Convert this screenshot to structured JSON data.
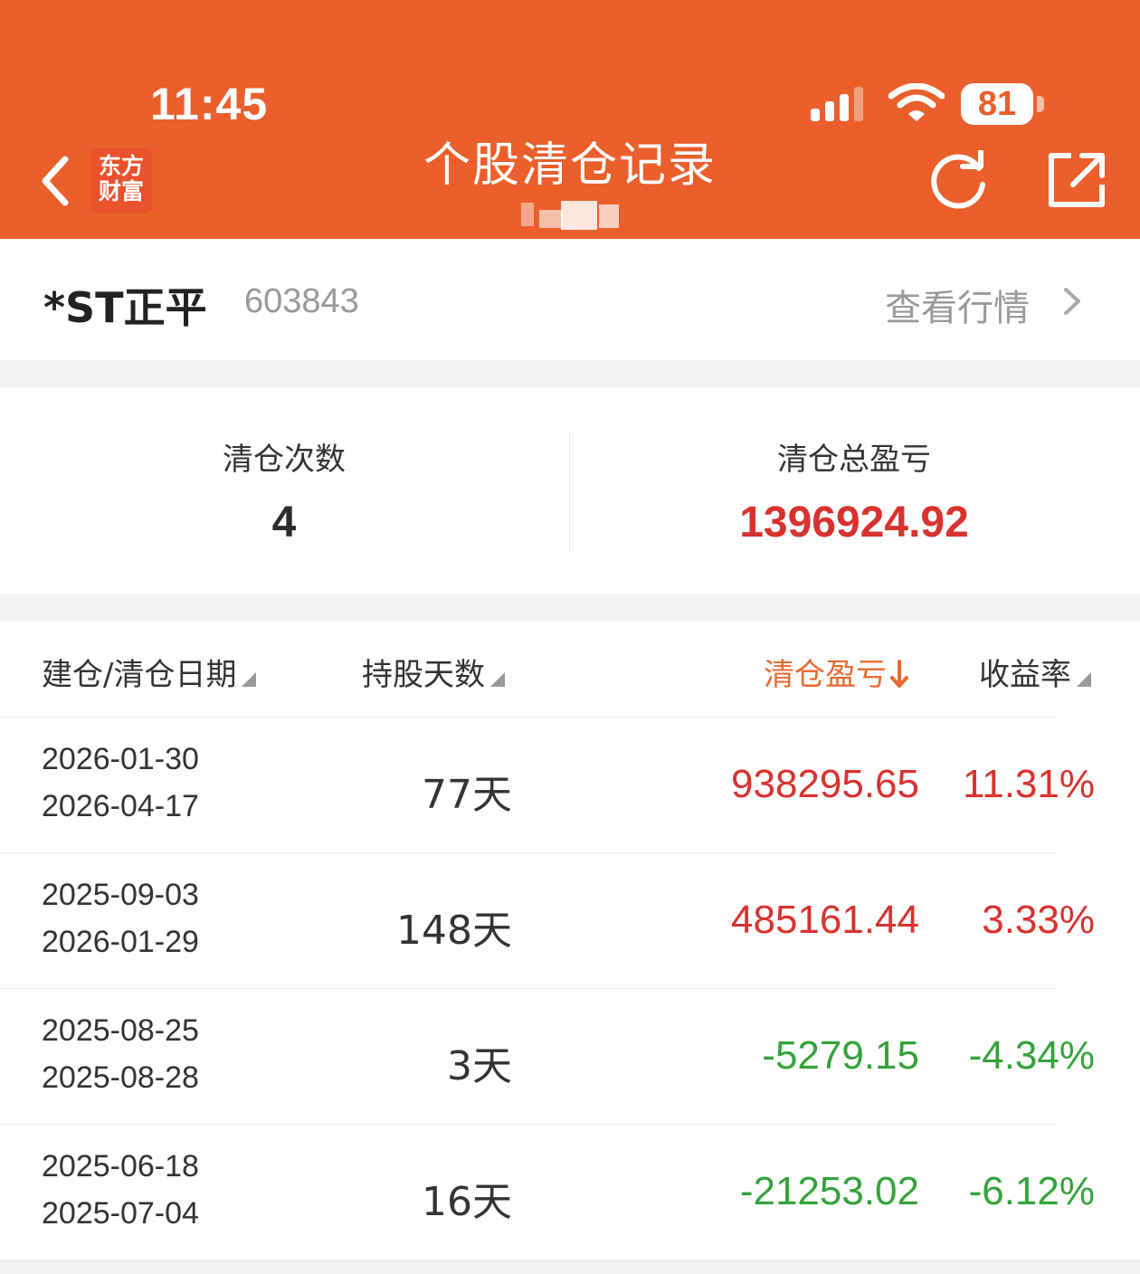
{
  "status_bar": {
    "time": "11:45",
    "battery": "81"
  },
  "header": {
    "title": "个股清仓记录",
    "logo_line1": "东方",
    "logo_line2": "财富"
  },
  "stock": {
    "name": "*ST正平",
    "code": "603843",
    "view_market_label": "查看行情"
  },
  "summary": {
    "count_label": "清仓次数",
    "count_value": "4",
    "total_label": "清仓总盈亏",
    "total_value": "1396924.92"
  },
  "table": {
    "headers": {
      "dates": "建仓/清仓日期",
      "days": "持股天数",
      "pnl": "清仓盈亏",
      "rate": "收益率"
    },
    "rows": [
      {
        "open_date": "2026-01-30",
        "close_date": "2026-04-17",
        "days": "77天",
        "pnl": "938295.65",
        "rate": "11.31%",
        "direction": "gain"
      },
      {
        "open_date": "2025-09-03",
        "close_date": "2026-01-29",
        "days": "148天",
        "pnl": "485161.44",
        "rate": "3.33%",
        "direction": "gain"
      },
      {
        "open_date": "2025-08-25",
        "close_date": "2025-08-28",
        "days": "3天",
        "pnl": "-5279.15",
        "rate": "-4.34%",
        "direction": "loss"
      },
      {
        "open_date": "2025-06-18",
        "close_date": "2025-07-04",
        "days": "16天",
        "pnl": "-21253.02",
        "rate": "-6.12%",
        "direction": "loss"
      }
    ]
  },
  "colors": {
    "header_bg": "#ea5f2c",
    "gain": "#d8322e",
    "loss": "#35a23c",
    "active_sort": "#e9692f"
  },
  "icons": [
    "back-chevron-icon",
    "cellular-signal-icon",
    "wifi-icon",
    "battery-icon",
    "refresh-icon",
    "share-icon",
    "chevron-right-icon",
    "sort-triangle-icon",
    "sort-down-arrow-icon"
  ]
}
